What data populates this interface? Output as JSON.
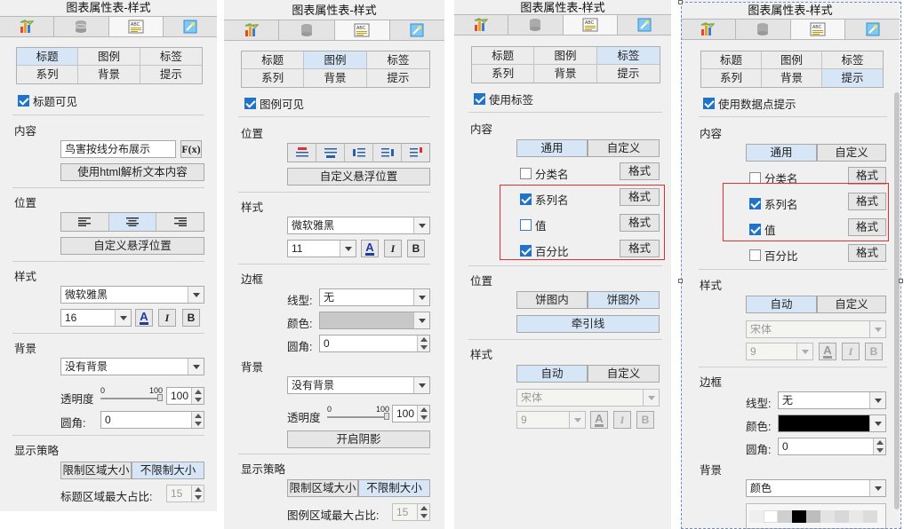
{
  "p1": {
    "title": "图表属性表-样式",
    "seg": [
      "标题",
      "图例",
      "标签",
      "系列",
      "背景",
      "提示"
    ],
    "visible_label": "标题可见",
    "content_label": "内容",
    "content_value": "鸟害按线分布展示",
    "fx_label": "F(x)",
    "html_btn": "使用html解析文本内容",
    "pos_label": "位置",
    "float_btn": "自定义悬浮位置",
    "style_label": "样式",
    "font": "微软雅黑",
    "size": "16",
    "bg_label": "背景",
    "bg_value": "没有背景",
    "opacity_label": "透明度",
    "slider_lo": "0",
    "slider_hi": "100",
    "opacity_value": "100",
    "radius_label": "圆角:",
    "radius_value": "0",
    "strategy_label": "显示策略",
    "limit_btn": "限制区域大小",
    "nolimit_btn": "不限制大小",
    "ratio_label": "标题区域最大占比:",
    "ratio_value": "15"
  },
  "p2": {
    "title": "图表属性表-样式",
    "seg": [
      "标题",
      "图例",
      "标签",
      "系列",
      "背景",
      "提示"
    ],
    "visible_label": "图例可见",
    "pos_label": "位置",
    "float_btn": "自定义悬浮位置",
    "style_label": "样式",
    "font": "微软雅黑",
    "size": "11",
    "border_label": "边框",
    "linetype_label": "线型:",
    "linetype_value": "无",
    "color_label": "颜色:",
    "radius_label": "圆角:",
    "radius_value": "0",
    "bg_label": "背景",
    "bg_value": "没有背景",
    "opacity_label": "透明度",
    "slider_lo": "0",
    "slider_hi": "100",
    "opacity_value": "100",
    "shadow_btn": "开启阴影",
    "strategy_label": "显示策略",
    "limit_btn": "限制区域大小",
    "nolimit_btn": "不限制大小",
    "ratio_label": "图例区域最大占比:",
    "ratio_value": "15"
  },
  "p3": {
    "title": "图表属性表-样式",
    "seg": [
      "标题",
      "图例",
      "标签",
      "系列",
      "背景",
      "提示"
    ],
    "use_label": "使用标签",
    "content_label": "内容",
    "general": "通用",
    "custom": "自定义",
    "category_name": "分类名",
    "series_name": "系列名",
    "value": "值",
    "percent": "百分比",
    "format": "格式",
    "pos_label": "位置",
    "inside": "饼图内",
    "outside": "饼图外",
    "leader": "牵引线",
    "style_label": "样式",
    "auto": "自动",
    "font": "宋体",
    "size": "9"
  },
  "p4": {
    "title": "图表属性表-样式",
    "seg": [
      "标题",
      "图例",
      "标签",
      "系列",
      "背景",
      "提示"
    ],
    "use_label": "使用数据点提示",
    "content_label": "内容",
    "general": "通用",
    "custom": "自定义",
    "category_name": "分类名",
    "series_name": "系列名",
    "value": "值",
    "percent": "百分比",
    "format": "格式",
    "style_label": "样式",
    "auto": "自动",
    "font": "宋体",
    "size": "9",
    "border_label": "边框",
    "linetype_label": "线型:",
    "linetype_value": "无",
    "color_label": "颜色:",
    "radius_label": "圆角:",
    "radius_value": "0",
    "bg_label": "背景",
    "bg_value": "颜色"
  },
  "common": {
    "bold": "B",
    "italic": "I",
    "fontcolor": "A"
  }
}
